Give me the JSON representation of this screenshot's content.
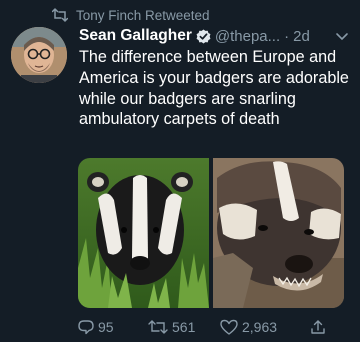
{
  "retweet": {
    "icon": "retweet-icon",
    "text": "Tony Finch Retweeted"
  },
  "author": {
    "name": "Sean Gallagher",
    "handle": "@thepa...",
    "separator": "·",
    "time": "2d",
    "verified_icon": "verified-badge-icon"
  },
  "tweet": {
    "text": "The difference between Europe and America is your badgers are adorable while our badgers are snarling ambulatory carpets of death"
  },
  "actions": {
    "replies": "95",
    "retweets": "561",
    "likes": "2,963"
  },
  "colors": {
    "background": "#141d26",
    "muted": "#8899a6",
    "verified": "#1da1f2",
    "text": "#ffffff"
  }
}
